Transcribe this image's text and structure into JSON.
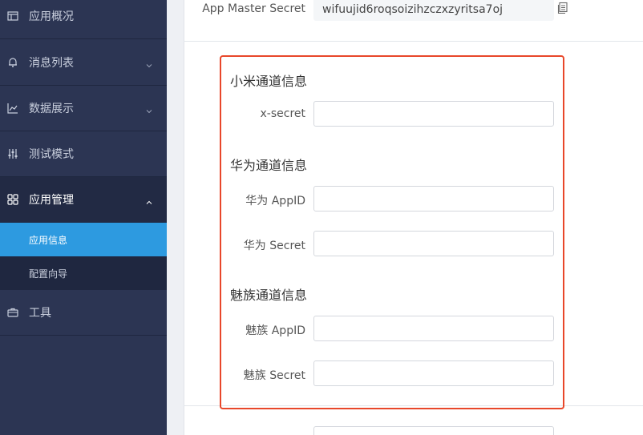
{
  "sidebar": {
    "items": [
      {
        "label": "应用概况",
        "icon": "overview-icon",
        "has_chevron": false
      },
      {
        "label": "消息列表",
        "icon": "bell-icon",
        "has_chevron": true
      },
      {
        "label": "数据展示",
        "icon": "chart-icon",
        "has_chevron": true
      },
      {
        "label": "测试模式",
        "icon": "sliders-icon",
        "has_chevron": false
      },
      {
        "label": "应用管理",
        "icon": "grid-icon",
        "has_chevron": true,
        "expanded": true
      },
      {
        "label": "工具",
        "icon": "toolbox-icon",
        "has_chevron": false
      }
    ],
    "sub_items": [
      {
        "label": "应用信息",
        "selected": true
      },
      {
        "label": "配置向导",
        "selected": false
      }
    ]
  },
  "top_field": {
    "label": "App Master Secret",
    "value": "wifuujid6roqsoizihzczxzyritsa7oj"
  },
  "xiaomi": {
    "title": "小米通道信息",
    "fields": [
      {
        "label": "x-secret",
        "value": ""
      }
    ]
  },
  "huawei": {
    "title": "华为通道信息",
    "fields": [
      {
        "label": "华为 AppID",
        "value": ""
      },
      {
        "label": "华为 Secret",
        "value": ""
      }
    ]
  },
  "meizu": {
    "title": "魅族通道信息",
    "fields": [
      {
        "label": "魅族 AppID",
        "value": ""
      },
      {
        "label": "魅族 Secret",
        "value": ""
      }
    ]
  },
  "colors": {
    "sidebar_bg": "#2c3553",
    "selected_bg": "#2d9ae0",
    "highlight_border": "#e8472a"
  }
}
